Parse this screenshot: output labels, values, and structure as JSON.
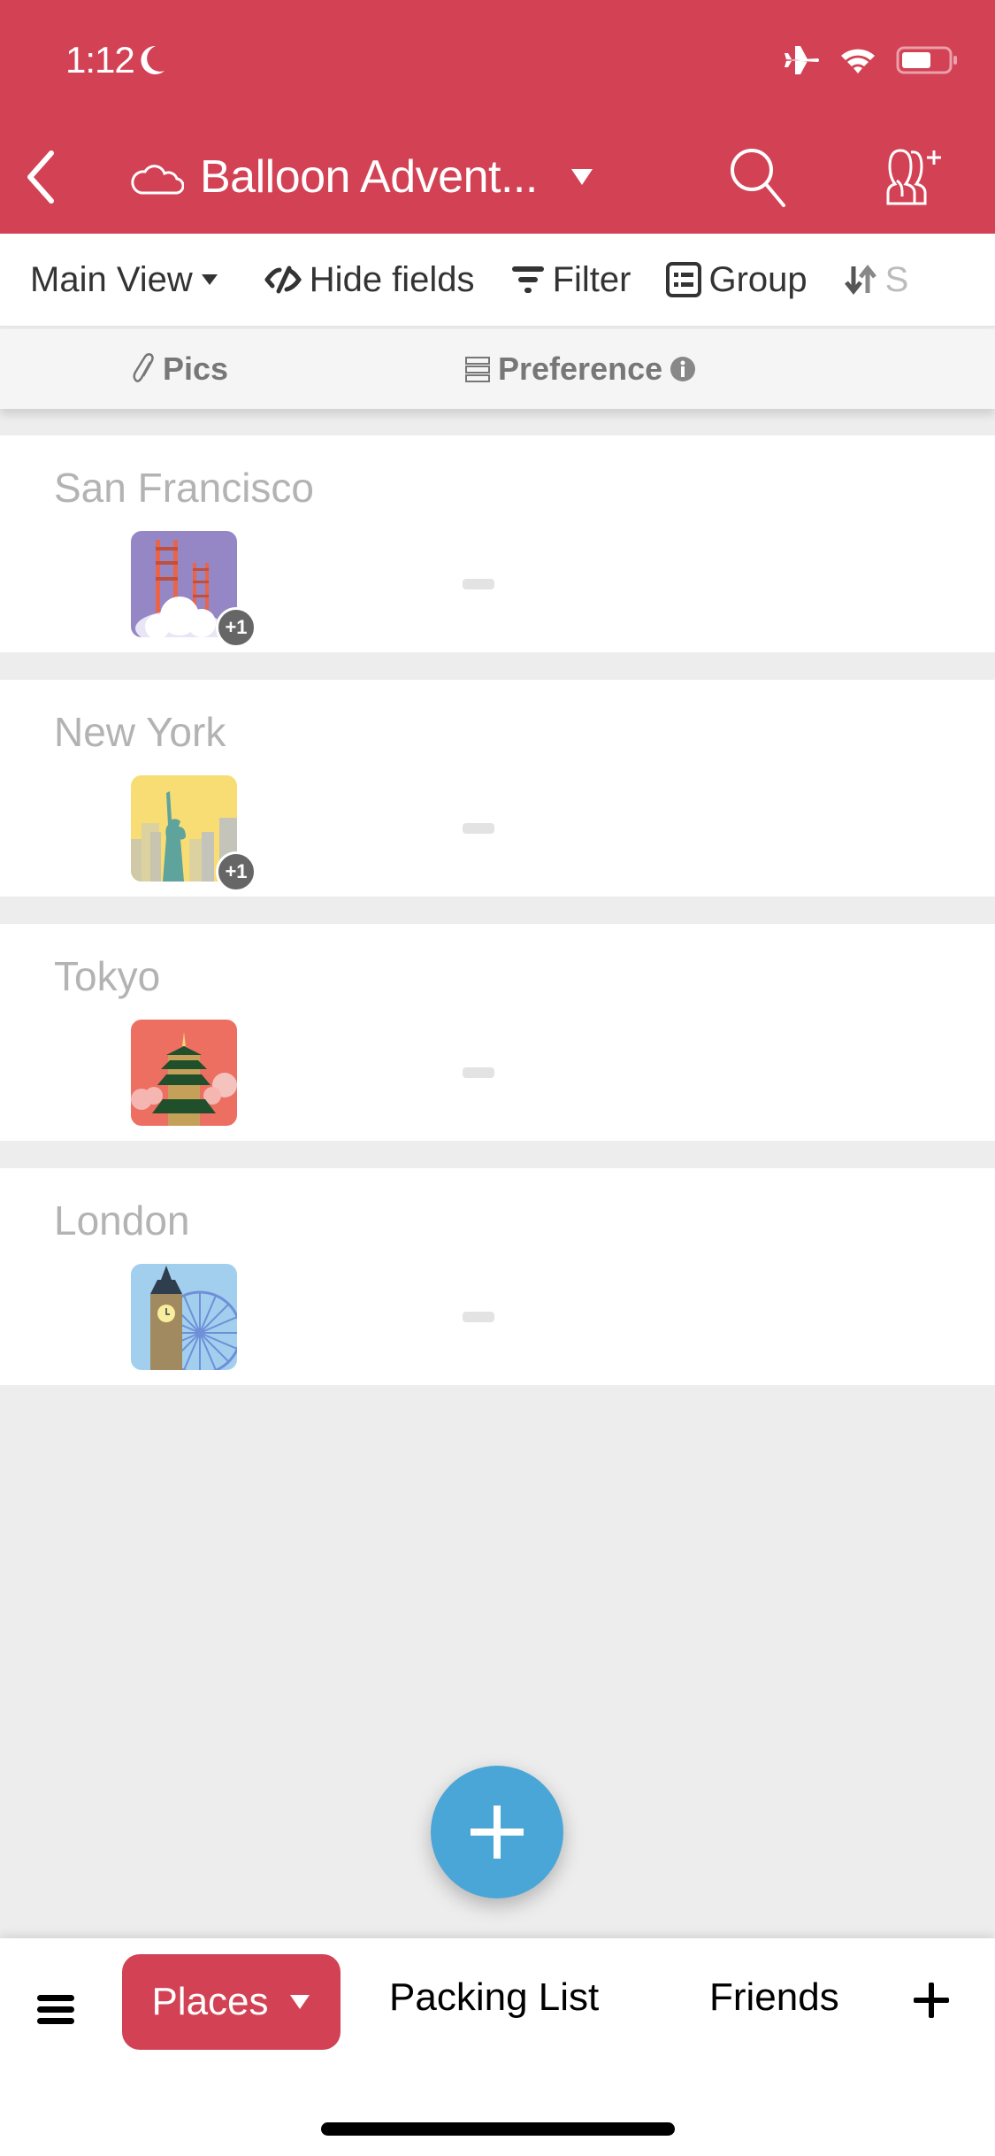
{
  "status_bar": {
    "time": "1:12",
    "icons": [
      "moon-icon",
      "airplane-icon",
      "wifi-icon",
      "battery-icon"
    ]
  },
  "header": {
    "title": "Balloon Advent...",
    "icons": {
      "back": "chevron-left-icon",
      "base": "cloud-icon",
      "caret": "caret-down-icon",
      "search": "search-icon",
      "share": "add-collaborator-icon"
    }
  },
  "toolbar": {
    "view_label": "Main View",
    "hide_fields_label": "Hide fields",
    "filter_label": "Filter",
    "group_label": "Group",
    "sort_label": "S"
  },
  "columns": [
    {
      "label": "Pics",
      "icon": "paperclip-icon"
    },
    {
      "label": "Preference",
      "icon": "multi-select-icon",
      "info_icon": "info-icon"
    }
  ],
  "records": [
    {
      "name": "San Francisco",
      "image": "golden-gate-bridge",
      "extra_count": "+1",
      "preference": ""
    },
    {
      "name": "New York",
      "image": "statue-of-liberty",
      "extra_count": "+1",
      "preference": ""
    },
    {
      "name": "Tokyo",
      "image": "pagoda",
      "extra_count": "",
      "preference": ""
    },
    {
      "name": "London",
      "image": "big-ben",
      "extra_count": "",
      "preference": ""
    }
  ],
  "fab": {
    "icon": "plus-icon"
  },
  "bottom_tabs": {
    "active": "Places",
    "tabs": [
      "Places",
      "Packing List",
      "Friends"
    ]
  },
  "colors": {
    "brand": "#d34154",
    "fab": "#4aa6d6",
    "background": "#ededed"
  }
}
